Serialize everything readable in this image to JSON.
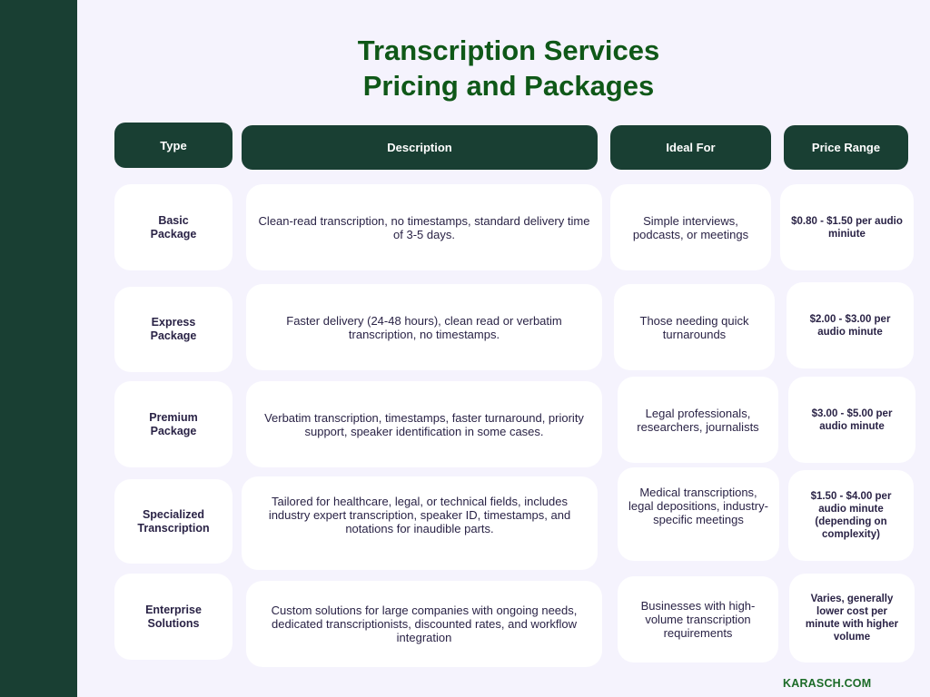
{
  "title": {
    "line1": "Transcription Services",
    "line2": "Pricing and Packages"
  },
  "colors": {
    "title": "#0f5818",
    "header_bg": "#193f33",
    "sidebar": "#193f33",
    "page_bg": "#f5f3fd",
    "cell_bg": "#ffffff",
    "text": "#2a2346",
    "footer": "#1b6b27"
  },
  "headers": {
    "type": "Type",
    "description": "Description",
    "ideal_for": "Ideal For",
    "price_range": "Price Range"
  },
  "rows": [
    {
      "type": "Basic\nPackage",
      "description": "Clean-read transcription, no timestamps, standard delivery time of 3-5 days.",
      "ideal_for": "Simple interviews, podcasts, or meetings",
      "price_range": "$0.80 - $1.50 per audio miniute"
    },
    {
      "type": "Express\nPackage",
      "description": "Faster delivery (24-48 hours), clean read or verbatim transcription, no timestamps.",
      "ideal_for": "Those needing quick turnarounds",
      "price_range": "$2.00 - $3.00 per audio minute"
    },
    {
      "type": "Premium\nPackage",
      "description": "Verbatim transcription, timestamps, faster turnaround, priority support, speaker identification in some cases.",
      "ideal_for": "Legal professionals, researchers, journalists",
      "price_range": "$3.00 - $5.00 per audio minute"
    },
    {
      "type": "Specialized\nTranscription",
      "description": "Tailored for healthcare, legal, or technical fields, includes industry expert transcription, speaker ID, timestamps, and notations for inaudible parts.",
      "ideal_for": "Medical transcriptions, legal depositions, industry-specific meetings",
      "price_range": "$1.50 - $4.00 per audio minute (depending on complexity)"
    },
    {
      "type": "Enterprise\nSolutions",
      "description": "Custom solutions for large companies with ongoing needs, dedicated transcriptionists, discounted rates, and workflow integration",
      "ideal_for": "Businesses with high-volume transcription requirements",
      "price_range": "Varies, generally lower cost per minute with higher volume"
    }
  ],
  "footer": "KARASCH.COM"
}
